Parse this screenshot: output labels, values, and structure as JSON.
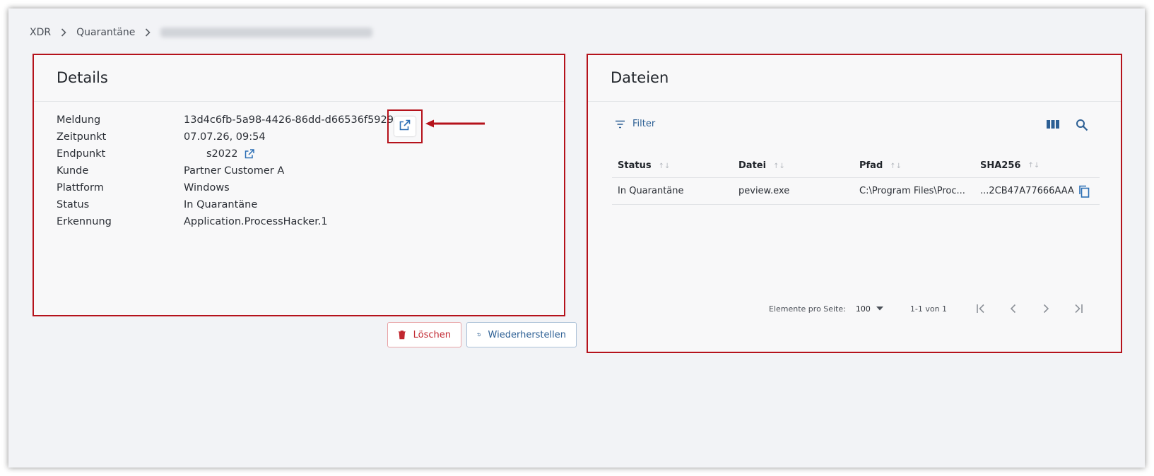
{
  "breadcrumb": {
    "root": "XDR",
    "section": "Quarantäne"
  },
  "details": {
    "title": "Details",
    "rows": [
      {
        "label": "Meldung",
        "value": "13d4c6fb-5a98-4426-86dd-d66536f5929a"
      },
      {
        "label": "Zeitpunkt",
        "value": "07.07.26, 09:54"
      },
      {
        "label": "Endpunkt",
        "value": "s2022"
      },
      {
        "label": "Kunde",
        "value": "Partner Customer A"
      },
      {
        "label": "Plattform",
        "value": "Windows"
      },
      {
        "label": "Status",
        "value": "In Quarantäne"
      },
      {
        "label": "Erkennung",
        "value": "Application.ProcessHacker.1"
      }
    ],
    "delete_label": "Löschen",
    "restore_label": "Wiederherstellen"
  },
  "files": {
    "title": "Dateien",
    "filter_label": "Filter",
    "columns": [
      "Status",
      "Datei",
      "Pfad",
      "SHA256"
    ],
    "rows": [
      {
        "status": "In Quarantäne",
        "file": "peview.exe",
        "path": "C:\\Program Files\\Proc...",
        "sha": "...2CB47A77666AAA"
      }
    ],
    "pager": {
      "per_page_label": "Elemente pro Seite:",
      "per_page_value": "100",
      "range": "1-1 von 1"
    }
  },
  "colors": {
    "highlight": "#b5121b",
    "accent": "#2c5f94",
    "danger": "#c1262f"
  },
  "icons": [
    "chevron-right-icon",
    "external-link-icon",
    "trash-icon",
    "restore-icon",
    "filter-icon",
    "columns-icon",
    "search-icon",
    "copy-icon",
    "first-page-icon",
    "prev-page-icon",
    "next-page-icon",
    "last-page-icon"
  ]
}
